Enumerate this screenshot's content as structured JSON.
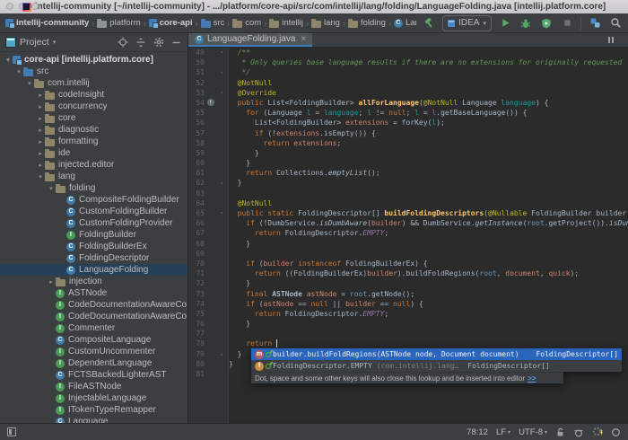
{
  "window": {
    "title": "intellij-community [~/intellij-community] - .../platform/core-api/src/com/intellij/lang/folding/LanguageFolding.java [intellij.platform.core]"
  },
  "glyphs": {
    "crumb_sep": "›",
    "dropdown": "▾",
    "tree_open": "▾",
    "tree_closed": "▸",
    "fold_open": "▾",
    "fold_close": "▴",
    "close": "×",
    "override_arrow": "↑"
  },
  "breadcrumbs": {
    "items": [
      {
        "label": "intellij-community",
        "icon": "module",
        "bold": true
      },
      {
        "label": "platform",
        "icon": "folder",
        "bold": false
      },
      {
        "label": "core-api",
        "icon": "module",
        "bold": true
      },
      {
        "label": "src",
        "icon": "src-folder",
        "bold": false
      },
      {
        "label": "com",
        "icon": "package",
        "bold": false
      },
      {
        "label": "intellij",
        "icon": "package",
        "bold": false
      },
      {
        "label": "lang",
        "icon": "package",
        "bold": false
      },
      {
        "label": "folding",
        "icon": "package",
        "bold": false
      },
      {
        "label": "LanguageFolding",
        "icon": "class",
        "bold": false
      }
    ]
  },
  "toolbar": {
    "run_config": "IDEA"
  },
  "project_panel": {
    "title": "Project",
    "tree": [
      {
        "label": "core-api [intellij.platform.core]",
        "icon": "module",
        "level": 0,
        "arrow": "open",
        "bold": true
      },
      {
        "label": "src",
        "icon": "src-folder",
        "level": 1,
        "arrow": "open"
      },
      {
        "label": "com.intellij",
        "icon": "package",
        "level": 2,
        "arrow": "open"
      },
      {
        "label": "codeInsight",
        "icon": "package",
        "level": 3,
        "arrow": "closed"
      },
      {
        "label": "concurrency",
        "icon": "package",
        "level": 3,
        "arrow": "closed"
      },
      {
        "label": "core",
        "icon": "package",
        "level": 3,
        "arrow": "closed"
      },
      {
        "label": "diagnostic",
        "icon": "package",
        "level": 3,
        "arrow": "closed"
      },
      {
        "label": "formatting",
        "icon": "package",
        "level": 3,
        "arrow": "closed"
      },
      {
        "label": "ide",
        "icon": "package",
        "level": 3,
        "arrow": "closed"
      },
      {
        "label": "injected.editor",
        "icon": "package",
        "level": 3,
        "arrow": "closed"
      },
      {
        "label": "lang",
        "icon": "package",
        "level": 3,
        "arrow": "open"
      },
      {
        "label": "folding",
        "icon": "package",
        "level": 4,
        "arrow": "open"
      },
      {
        "label": "CompositeFoldingBuilder",
        "icon": "class",
        "level": 5
      },
      {
        "label": "CustomFoldingBuilder",
        "icon": "class",
        "level": 5
      },
      {
        "label": "CustomFoldingProvider",
        "icon": "class",
        "level": 5
      },
      {
        "label": "FoldingBuilder",
        "icon": "interface",
        "level": 5
      },
      {
        "label": "FoldingBuilderEx",
        "icon": "class",
        "level": 5
      },
      {
        "label": "FoldingDescriptor",
        "icon": "class",
        "level": 5
      },
      {
        "label": "LanguageFolding",
        "icon": "class",
        "level": 5,
        "selected": true
      },
      {
        "label": "injection",
        "icon": "package",
        "level": 4,
        "arrow": "closed"
      },
      {
        "label": "ASTNode",
        "icon": "interface",
        "level": 4
      },
      {
        "label": "CodeDocumentationAwareCo",
        "icon": "interface",
        "level": 4
      },
      {
        "label": "CodeDocumentationAwareCo",
        "icon": "interface",
        "level": 4
      },
      {
        "label": "Commenter",
        "icon": "interface",
        "level": 4
      },
      {
        "label": "CompositeLanguage",
        "icon": "class",
        "level": 4
      },
      {
        "label": "CustomUncommenter",
        "icon": "interface",
        "level": 4
      },
      {
        "label": "DependentLanguage",
        "icon": "interface",
        "level": 4
      },
      {
        "label": "FCTSBackedLighterAST",
        "icon": "class",
        "level": 4
      },
      {
        "label": "FileASTNode",
        "icon": "interface",
        "level": 4
      },
      {
        "label": "InjectableLanguage",
        "icon": "interface",
        "level": 4
      },
      {
        "label": "ITokenTypeRemapper",
        "icon": "interface",
        "level": 4
      },
      {
        "label": "Language",
        "icon": "class",
        "level": 4
      }
    ]
  },
  "editor": {
    "tab": "LanguageFolding.java",
    "lines": [
      {
        "n": 49,
        "fold": "open",
        "seg": [
          [
            "cmt",
            "  /**"
          ]
        ]
      },
      {
        "n": 50,
        "seg": [
          [
            "cmt",
            "   * Only queries base language results if there are no extensions for originally requested"
          ]
        ]
      },
      {
        "n": 51,
        "fold": "close",
        "seg": [
          [
            "cmt",
            "   */"
          ]
        ]
      },
      {
        "n": 52,
        "seg": [
          [
            "ann",
            "  @NotNull"
          ]
        ]
      },
      {
        "n": 53,
        "fold": "open",
        "seg": [
          [
            "ann",
            "  @Override"
          ]
        ]
      },
      {
        "n": 54,
        "gicon": "override",
        "seg": [
          [
            "kw",
            "  public "
          ],
          [
            "pl",
            "List<FoldingBuilder> "
          ],
          [
            "mdecl",
            "allForLanguage"
          ],
          [
            "pl",
            "("
          ],
          [
            "ann",
            "@NotNull"
          ],
          [
            "pl",
            " Language "
          ],
          [
            "param",
            "language"
          ],
          [
            "pl",
            ") {"
          ]
        ]
      },
      {
        "n": 55,
        "seg": [
          [
            "pl",
            "    "
          ],
          [
            "kw",
            "for"
          ],
          [
            "pl",
            " (Language "
          ],
          [
            "param",
            "l"
          ],
          [
            "pl",
            " = "
          ],
          [
            "param",
            "language"
          ],
          [
            "pl",
            "; "
          ],
          [
            "param",
            "l"
          ],
          [
            "pl",
            " != "
          ],
          [
            "kw",
            "null"
          ],
          [
            "pl",
            "; "
          ],
          [
            "param",
            "l"
          ],
          [
            "pl",
            " = "
          ],
          [
            "param",
            "l"
          ],
          [
            "pl",
            ".getBaseLanguage()) {"
          ]
        ]
      },
      {
        "n": 56,
        "seg": [
          [
            "pl",
            "      List<FoldingBuilder> "
          ],
          [
            "local",
            "extensions"
          ],
          [
            "pl",
            " = forKey("
          ],
          [
            "param",
            "l"
          ],
          [
            "pl",
            ");"
          ]
        ]
      },
      {
        "n": 57,
        "seg": [
          [
            "pl",
            "      "
          ],
          [
            "kw",
            "if"
          ],
          [
            "pl",
            " (!"
          ],
          [
            "local",
            "extensions"
          ],
          [
            "pl",
            ".isEmpty()) {"
          ]
        ]
      },
      {
        "n": 58,
        "seg": [
          [
            "pl",
            "        "
          ],
          [
            "kw",
            "return"
          ],
          [
            "pl",
            " "
          ],
          [
            "local",
            "extensions"
          ],
          [
            "pl",
            ";"
          ]
        ]
      },
      {
        "n": 59,
        "seg": [
          [
            "pl",
            "      }"
          ]
        ]
      },
      {
        "n": 60,
        "seg": [
          [
            "pl",
            "    }"
          ]
        ]
      },
      {
        "n": 61,
        "seg": [
          [
            "pl",
            "    "
          ],
          [
            "kw",
            "return"
          ],
          [
            "pl",
            " Collections."
          ],
          [
            "sm",
            "emptyList"
          ],
          [
            "pl",
            "();"
          ]
        ]
      },
      {
        "n": 62,
        "fold": "close",
        "seg": [
          [
            "pl",
            "  }"
          ]
        ]
      },
      {
        "n": 63,
        "seg": []
      },
      {
        "n": 64,
        "seg": [
          [
            "ann",
            "  @NotNull"
          ]
        ]
      },
      {
        "n": 65,
        "fold": "open",
        "seg": [
          [
            "kw",
            "  public static "
          ],
          [
            "pl",
            "FoldingDescriptor[] "
          ],
          [
            "mdecl",
            "buildFoldingDescriptors"
          ],
          [
            "pl",
            "("
          ],
          [
            "ann",
            "@Nullable"
          ],
          [
            "pl",
            " FoldingBuilder builder"
          ]
        ]
      },
      {
        "n": 66,
        "seg": [
          [
            "pl",
            "    "
          ],
          [
            "kw",
            "if"
          ],
          [
            "pl",
            " (!DumbService."
          ],
          [
            "sm",
            "isDumbAware"
          ],
          [
            "pl",
            "("
          ],
          [
            "local",
            "builder"
          ],
          [
            "pl",
            ") && DumbService."
          ],
          [
            "sm",
            "getInstance"
          ],
          [
            "pl",
            "("
          ],
          [
            "rootv",
            "root"
          ],
          [
            "pl",
            ".getProject())."
          ],
          [
            "sm",
            "isDum"
          ]
        ]
      },
      {
        "n": 67,
        "seg": [
          [
            "pl",
            "      "
          ],
          [
            "kw",
            "return"
          ],
          [
            "pl",
            " FoldingDescriptor."
          ],
          [
            "const",
            "EMPTY"
          ],
          [
            "pl",
            ";"
          ]
        ]
      },
      {
        "n": 68,
        "seg": [
          [
            "pl",
            "    }"
          ]
        ]
      },
      {
        "n": 69,
        "seg": []
      },
      {
        "n": 70,
        "seg": [
          [
            "pl",
            "    "
          ],
          [
            "kw",
            "if"
          ],
          [
            "pl",
            " ("
          ],
          [
            "local",
            "builder"
          ],
          [
            "pl",
            " "
          ],
          [
            "kw",
            "instanceof"
          ],
          [
            "pl",
            " FoldingBuilderEx) {"
          ]
        ]
      },
      {
        "n": 71,
        "seg": [
          [
            "pl",
            "      "
          ],
          [
            "kw",
            "return"
          ],
          [
            "pl",
            " ((FoldingBuilderEx)"
          ],
          [
            "local",
            "builder"
          ],
          [
            "pl",
            ").buildFoldRegions("
          ],
          [
            "rootv",
            "root"
          ],
          [
            "pl",
            ", "
          ],
          [
            "local",
            "document"
          ],
          [
            "pl",
            ", "
          ],
          [
            "local",
            "quick"
          ],
          [
            "pl",
            ");"
          ]
        ]
      },
      {
        "n": 72,
        "seg": [
          [
            "pl",
            "    }"
          ]
        ]
      },
      {
        "n": 73,
        "seg": [
          [
            "pl",
            "    "
          ],
          [
            "kw",
            "final"
          ],
          [
            "pl",
            " "
          ],
          [
            "b",
            "ASTNode"
          ],
          [
            "pl",
            " "
          ],
          [
            "local",
            "astNode"
          ],
          [
            "pl",
            " = "
          ],
          [
            "rootv",
            "root"
          ],
          [
            "pl",
            ".getNode();"
          ]
        ]
      },
      {
        "n": 74,
        "seg": [
          [
            "pl",
            "    "
          ],
          [
            "kw",
            "if"
          ],
          [
            "pl",
            " ("
          ],
          [
            "local",
            "astNode"
          ],
          [
            "pl",
            " == "
          ],
          [
            "kw",
            "null"
          ],
          [
            "pl",
            " || "
          ],
          [
            "local",
            "builder"
          ],
          [
            "pl",
            " == "
          ],
          [
            "kw",
            "null"
          ],
          [
            "pl",
            ") {"
          ]
        ]
      },
      {
        "n": 75,
        "seg": [
          [
            "pl",
            "      "
          ],
          [
            "kw",
            "return"
          ],
          [
            "pl",
            " FoldingDescriptor."
          ],
          [
            "const",
            "EMPTY"
          ],
          [
            "pl",
            ";"
          ]
        ]
      },
      {
        "n": 76,
        "seg": [
          [
            "pl",
            "    }"
          ]
        ]
      },
      {
        "n": 77,
        "seg": []
      },
      {
        "n": 78,
        "caret": true,
        "seg": [
          [
            "pl",
            "    "
          ],
          [
            "kw",
            "return"
          ],
          [
            "pl",
            " "
          ]
        ]
      },
      {
        "n": 79,
        "fold": "close",
        "seg": [
          [
            "pl",
            "  }"
          ]
        ]
      },
      {
        "n": 80,
        "seg": [
          [
            "pl",
            "}"
          ]
        ]
      },
      {
        "n": 81,
        "seg": []
      }
    ]
  },
  "popup": {
    "rows": [
      {
        "kind": "method",
        "label": "builder.buildFoldRegions(ASTNode node, Document document)",
        "type": "FoldingDescriptor[]",
        "selected": true
      },
      {
        "kind": "field",
        "label": "FoldingDescriptor.EMPTY",
        "note": "(com.intellij.lang…",
        "type": "FoldingDescriptor[]"
      }
    ],
    "footer": "Dot, space and some other keys will also close this lookup and be inserted into editor",
    "footer_link": ">>"
  },
  "status_bar": {
    "cursor_position": "78:12",
    "line_separator": "LF",
    "encoding": "UTF-8"
  },
  "colors": {
    "editor_bg": "#2b2b2b",
    "panel_bg": "#3c3f41",
    "selection_blue": "#2a65bd",
    "tree_selection": "#27405a",
    "accent_green": "#59A869",
    "tab_underline": "#3d7dbd"
  }
}
